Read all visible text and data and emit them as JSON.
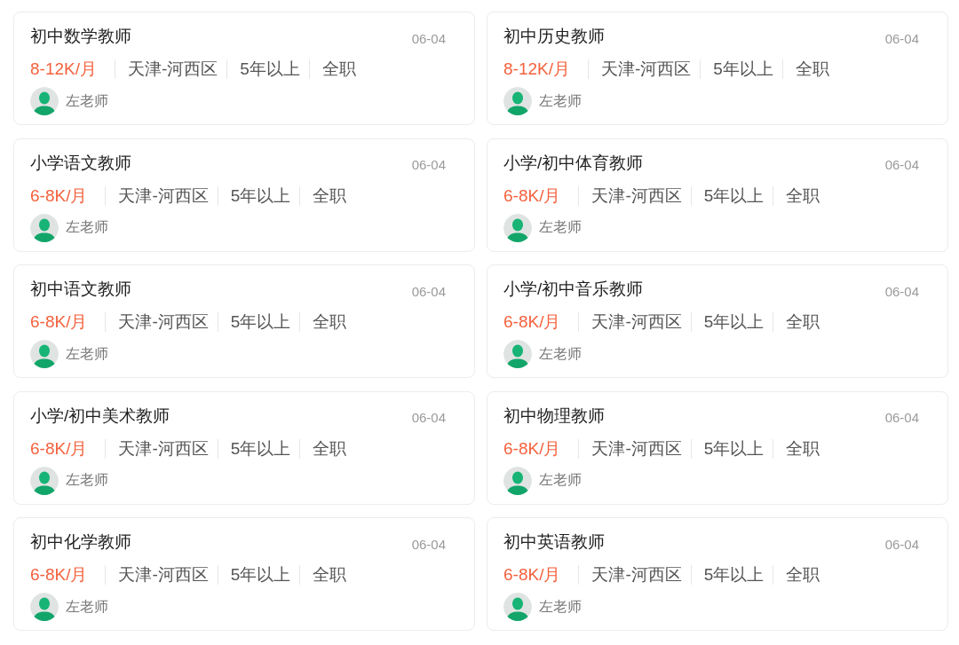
{
  "jobs": [
    {
      "title": "初中数学教师",
      "date": "06-04",
      "salary": "8-12K/月",
      "tags": [
        "天津-河西区",
        "5年以上",
        "全职"
      ],
      "contact": "左老师"
    },
    {
      "title": "初中历史教师",
      "date": "06-04",
      "salary": "8-12K/月",
      "tags": [
        "天津-河西区",
        "5年以上",
        "全职"
      ],
      "contact": "左老师"
    },
    {
      "title": "小学语文教师",
      "date": "06-04",
      "salary": "6-8K/月",
      "tags": [
        "天津-河西区",
        "5年以上",
        "全职"
      ],
      "contact": "左老师"
    },
    {
      "title": "小学/初中体育教师",
      "date": "06-04",
      "salary": "6-8K/月",
      "tags": [
        "天津-河西区",
        "5年以上",
        "全职"
      ],
      "contact": "左老师"
    },
    {
      "title": "初中语文教师",
      "date": "06-04",
      "salary": "6-8K/月",
      "tags": [
        "天津-河西区",
        "5年以上",
        "全职"
      ],
      "contact": "左老师"
    },
    {
      "title": "小学/初中音乐教师",
      "date": "06-04",
      "salary": "6-8K/月",
      "tags": [
        "天津-河西区",
        "5年以上",
        "全职"
      ],
      "contact": "左老师"
    },
    {
      "title": "小学/初中美术教师",
      "date": "06-04",
      "salary": "6-8K/月",
      "tags": [
        "天津-河西区",
        "5年以上",
        "全职"
      ],
      "contact": "左老师"
    },
    {
      "title": "初中物理教师",
      "date": "06-04",
      "salary": "6-8K/月",
      "tags": [
        "天津-河西区",
        "5年以上",
        "全职"
      ],
      "contact": "左老师"
    },
    {
      "title": "初中化学教师",
      "date": "06-04",
      "salary": "6-8K/月",
      "tags": [
        "天津-河西区",
        "5年以上",
        "全职"
      ],
      "contact": "左老师"
    },
    {
      "title": "初中英语教师",
      "date": "06-04",
      "salary": "6-8K/月",
      "tags": [
        "天津-河西区",
        "5年以上",
        "全职"
      ],
      "contact": "左老师"
    }
  ]
}
